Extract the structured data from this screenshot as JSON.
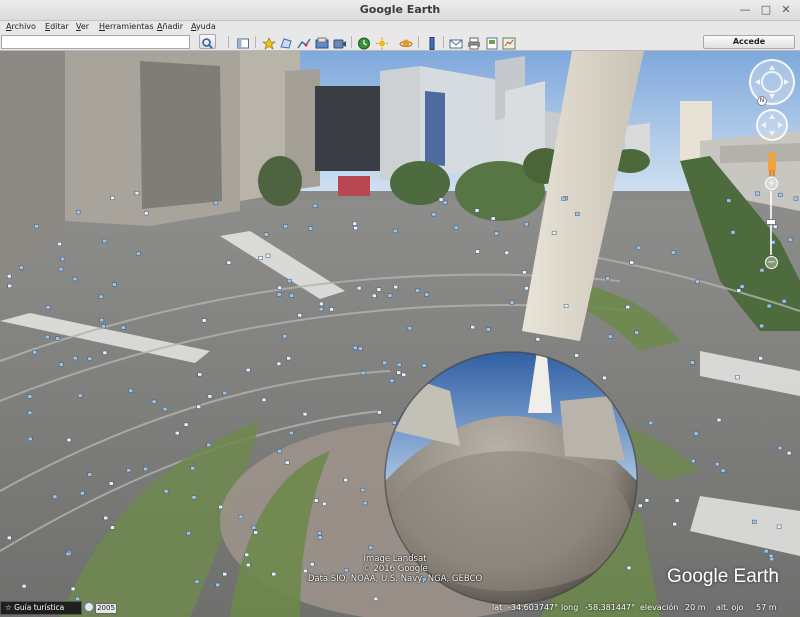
{
  "window": {
    "title": "Google Earth"
  },
  "menu": [
    "Archivo",
    "Editar",
    "Ver",
    "Herramientas",
    "Añadir",
    "Ayuda"
  ],
  "toolbar": {
    "search_value": "",
    "signin_label": "Accede",
    "icons": [
      "sidebar-toggle-icon",
      "placemark-icon",
      "polygon-icon",
      "path-icon",
      "image-overlay-icon",
      "record-tour-icon",
      "historical-imagery-icon",
      "sunlight-icon",
      "planets-icon",
      "ruler-icon",
      "email-icon",
      "print-icon",
      "save-image-icon",
      "view-in-maps-icon"
    ]
  },
  "view": {
    "credits_line1": "Image Landsat",
    "credits_line2": "© 2016 Google",
    "credits_line3": "Data SIO, NOAA, U.S. Navy, NGA, GEBCO",
    "logo_text": "Google Earth",
    "tour_label": "Guía turística",
    "imagery_year": "2005"
  },
  "status": {
    "lat_label": "lat",
    "lat_value": "-34.603747°",
    "lng_label": "long",
    "lng_value": "-58.381447°",
    "elev_label": "elevación",
    "elev_value": "20 m",
    "eye_label": "alt. ojo",
    "eye_value": "57 m"
  },
  "colors": {
    "sky": "#9cc0e6",
    "road": "#8f8f8e",
    "grass": "#6f8a4f",
    "accent_orange": "#d08a2a"
  }
}
